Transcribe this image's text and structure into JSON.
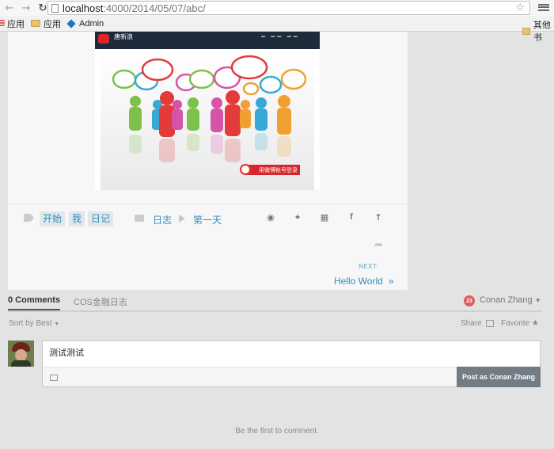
{
  "browser": {
    "url_host": "localhost",
    "url_path": ":4000/2014/05/07/abc/",
    "icons": [
      "back-icon",
      "forward-icon",
      "reload-icon",
      "page-icon",
      "star-icon",
      "menu-icon"
    ]
  },
  "bookmarks": {
    "items": [
      {
        "label": "应用",
        "icon": "apps-icon"
      },
      {
        "label": "应用",
        "icon": "folder-icon"
      },
      {
        "label": "Admin",
        "icon": "admin-icon"
      }
    ],
    "other": "其他书"
  },
  "article": {
    "hero": {
      "brand": "唐新浪",
      "button": "用微博帐号登录"
    },
    "tags": [
      "开始",
      "我",
      "日记"
    ],
    "categories": [
      "日志",
      "第一天"
    ],
    "share_icons": [
      "weibo-icon",
      "twitter-icon",
      "qrcode-icon",
      "facebook-icon",
      "back-to-top-icon",
      "share-forward-icon"
    ],
    "next_label": "NEXT:",
    "next_title": "Hello World",
    "next_arrow": "»"
  },
  "disqus": {
    "tab_comments": "0 Comments",
    "tab_forum": "COS金融日志",
    "notification_count": "23",
    "user_name": "Conan Zhang",
    "sort_label": "Sort by Best",
    "share_label": "Share",
    "favorite_label": "Favorite",
    "comment_text": "测试测试",
    "post_button": "Post as Conan Zhang",
    "empty_message": "Be the first to comment."
  },
  "colors": {
    "link": "#2e8fc1",
    "tag_bg": "#e2e7ea",
    "post_button": "#727c85",
    "badge": "#e35a5a"
  }
}
